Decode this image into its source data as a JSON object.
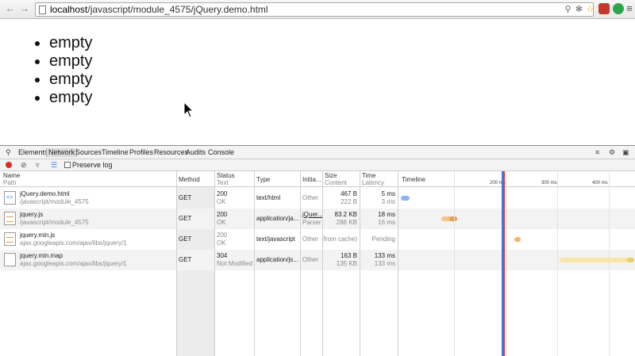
{
  "browser": {
    "url_host": "localhost",
    "url_path": "/javascript/module_4575/jQuery.demo.html"
  },
  "page": {
    "list_items": [
      "empty",
      "empty",
      "empty",
      "empty"
    ]
  },
  "devtools": {
    "tabs": [
      "Elements",
      "Network",
      "Sources",
      "Timeline",
      "Profiles",
      "Resources",
      "Audits",
      "Console"
    ],
    "selected_tab": "Network",
    "preserve_log_label": "Preserve log",
    "columns": {
      "name": "Name",
      "name_sub": "Path",
      "method": "Method",
      "status": "Status",
      "status_sub": "Text",
      "type": "Type",
      "initiator": "Initia...",
      "size": "Size",
      "size_sub": "Content",
      "time": "Time",
      "time_sub": "Latency",
      "timeline": "Timeline"
    },
    "timeline_ticks": [
      "200 ms",
      "300 ms",
      "400 ms"
    ],
    "rows": [
      {
        "name": "jQuery.demo.html",
        "path": "/javascript/module_4575",
        "method": "GET",
        "status": "200",
        "status_text": "OK",
        "type": "text/html",
        "initiator": "Other",
        "initiator_sub": "",
        "size": "467 B",
        "content": "222 B",
        "time": "5 ms",
        "latency": "3 ms",
        "icon": "html-file-icon",
        "bar_color": "#8ab4f8"
      },
      {
        "name": "jquery.js",
        "path": "/javascript/module_4575",
        "method": "GET",
        "status": "200",
        "status_text": "OK",
        "type": "application/ja...",
        "initiator": "jQuer...",
        "initiator_sub": "Parser",
        "size": "83.2 KB",
        "content": "286 KB",
        "time": "18 ms",
        "latency": "16 ms",
        "icon": "script-file-icon",
        "bar_color": "#f4b66b"
      },
      {
        "name": "jquery.min.js",
        "path": "ajax.googleapis.com/ajax/libs/jquery/1",
        "method": "GET",
        "status": "200",
        "status_text": "OK",
        "type": "text/javascript",
        "initiator": "Other",
        "initiator_sub": "",
        "size": "(from cache)",
        "content": "",
        "time": "Pending",
        "latency": "",
        "icon": "script-file-icon",
        "bar_color": "#f4b66b"
      },
      {
        "name": "jquery.min.map",
        "path": "ajax.googleapis.com/ajax/libs/jquery/1",
        "method": "GET",
        "status": "304",
        "status_text": "Not Modified",
        "type": "application/js...",
        "initiator": "Other",
        "initiator_sub": "",
        "size": "163 B",
        "content": "135 KB",
        "time": "133 ms",
        "latency": "133 ms",
        "icon": "generic-file-icon",
        "bar_color": "#f6e7a6"
      }
    ]
  }
}
